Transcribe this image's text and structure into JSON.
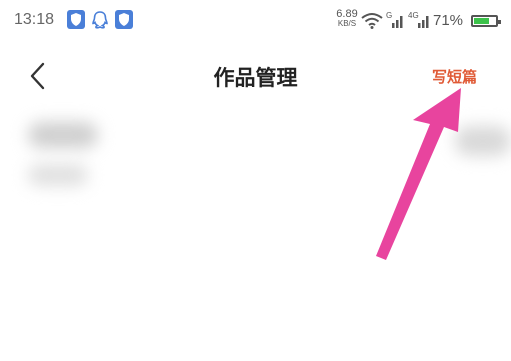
{
  "status_bar": {
    "time": "13:18",
    "net_speed_value": "6.89",
    "net_speed_unit": "KB/S",
    "signal1_label": "G",
    "signal2_label": "4G",
    "battery_percent": "71%",
    "battery_level": 0.71,
    "icons": [
      "shield-icon",
      "qq-icon",
      "shield-icon",
      "wifi-icon",
      "signal-icon",
      "signal-icon",
      "battery-icon"
    ]
  },
  "nav": {
    "back_icon": "chevron-left-icon",
    "title": "作品管理",
    "write_short_label": "写短篇"
  },
  "colors": {
    "accent": "#e05a36",
    "annotation_arrow": "#e8449e",
    "shield_blue": "#4a7fd8",
    "battery_green": "#3cc24a"
  }
}
